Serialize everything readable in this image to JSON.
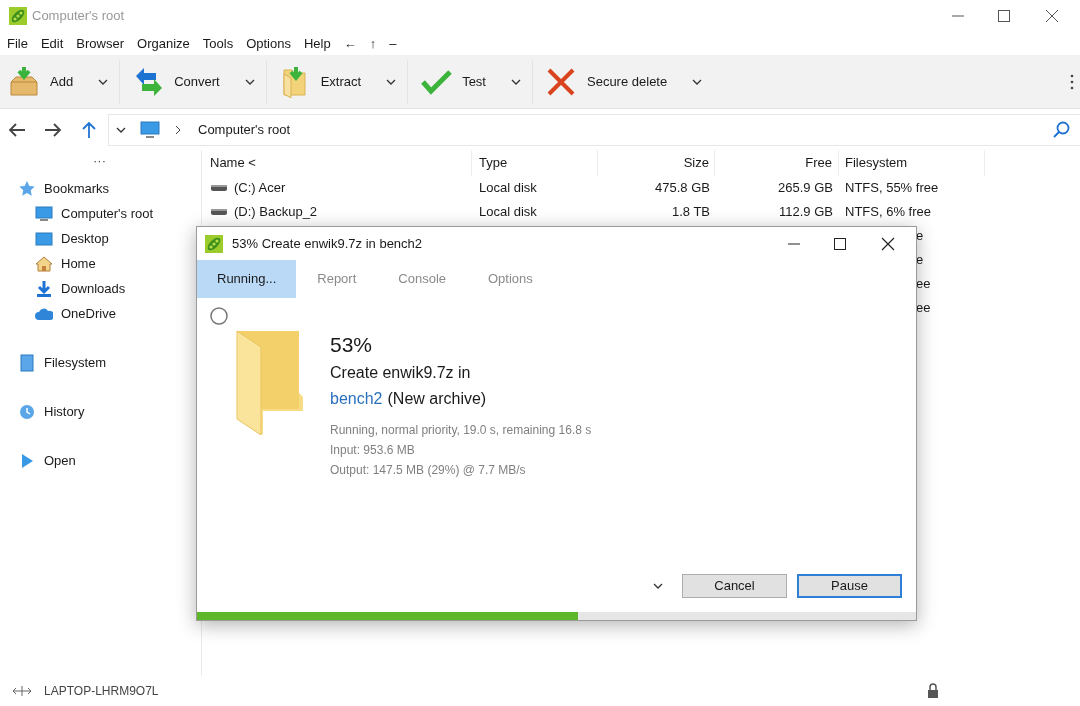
{
  "window": {
    "title": "Computer's root"
  },
  "menu": [
    "File",
    "Edit",
    "Browser",
    "Organize",
    "Tools",
    "Options",
    "Help",
    "←",
    "↑",
    "–"
  ],
  "toolbar": [
    {
      "label": "Add",
      "kind": "add"
    },
    {
      "label": "Convert",
      "kind": "convert"
    },
    {
      "label": "Extract",
      "kind": "extract"
    },
    {
      "label": "Test",
      "kind": "test"
    },
    {
      "label": "Secure delete",
      "kind": "delete"
    }
  ],
  "address": {
    "path": "Computer's root"
  },
  "sidebar": {
    "more": "···",
    "sections": [
      {
        "label": "Bookmarks",
        "kind": "bookmarks",
        "children": [
          {
            "label": "Computer's root",
            "kind": "computer"
          },
          {
            "label": "Desktop",
            "kind": "desktop"
          },
          {
            "label": "Home",
            "kind": "home"
          },
          {
            "label": "Downloads",
            "kind": "downloads"
          },
          {
            "label": "OneDrive",
            "kind": "cloud"
          }
        ]
      },
      {
        "label": "Filesystem",
        "kind": "filesystem"
      },
      {
        "label": "History",
        "kind": "history"
      },
      {
        "label": "Open",
        "kind": "open"
      }
    ]
  },
  "table": {
    "columns": [
      "Name <",
      "Type",
      "Size",
      "Free",
      "Filesystem"
    ],
    "rows": [
      {
        "name": "(C:) Acer",
        "type": "Local disk",
        "size": "475.8 GB",
        "free": "265.9 GB",
        "filesystem": "NTFS, 55% free"
      },
      {
        "name": "(D:) Backup_2",
        "type": "Local disk",
        "size": "1.8 TB",
        "free": "112.9 GB",
        "filesystem": "NTFS, 6% free"
      },
      {
        "filesystem": "e"
      },
      {
        "filesystem": "e"
      },
      {
        "filesystem": "ee"
      },
      {
        "filesystem": "ee"
      }
    ]
  },
  "dialog": {
    "title": "53% Create enwik9.7z in bench2",
    "tabs": [
      {
        "label": "Running...",
        "selected": true
      },
      {
        "label": "Report",
        "selected": false
      },
      {
        "label": "Console",
        "selected": false
      },
      {
        "label": "Options",
        "selected": false
      }
    ],
    "percent": "53%",
    "line1": "Create enwik9.7z in",
    "link": "bench2",
    "line2": "(New archive)",
    "details": [
      "Running, normal priority, 19.0 s, remaining 16.8 s",
      "Input: 953.6 MB",
      "Output: 147.5 MB (29%) @ 7.7 MB/s"
    ],
    "buttons": [
      {
        "label": "Cancel",
        "selected": false
      },
      {
        "label": "Pause",
        "selected": true
      }
    ],
    "progress": {
      "level": 0.53
    }
  },
  "status_bar": {
    "computer": "LAPTOP-LHRM9O7L"
  }
}
